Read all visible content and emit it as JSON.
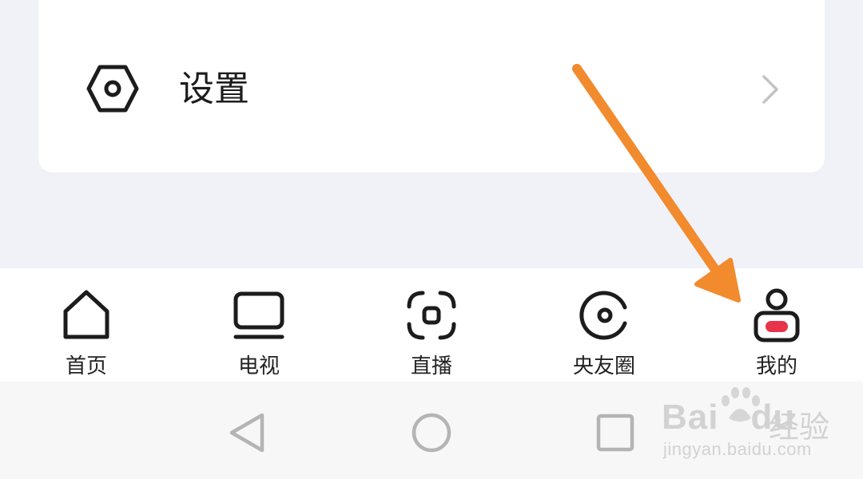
{
  "settings": {
    "label": "设置",
    "icon": "hexagon-nut-icon"
  },
  "tabs": [
    {
      "label": "首页",
      "icon": "home-icon"
    },
    {
      "label": "电视",
      "icon": "tv-icon"
    },
    {
      "label": "直播",
      "icon": "live-icon"
    },
    {
      "label": "央友圈",
      "icon": "circle-icon"
    },
    {
      "label": "我的",
      "icon": "profile-icon",
      "selected": true
    }
  ],
  "navigation": [
    "back-triangle-icon",
    "home-circle-icon",
    "recents-square-icon"
  ],
  "colors": {
    "accent": "#e8344a",
    "arrow": "#f28a2e",
    "icon_stroke": "#1c1c1c"
  },
  "watermark": {
    "brand_prefix": "Bai",
    "brand_suffix": "du",
    "product": "经验",
    "url": "jingyan.baidu.com"
  }
}
